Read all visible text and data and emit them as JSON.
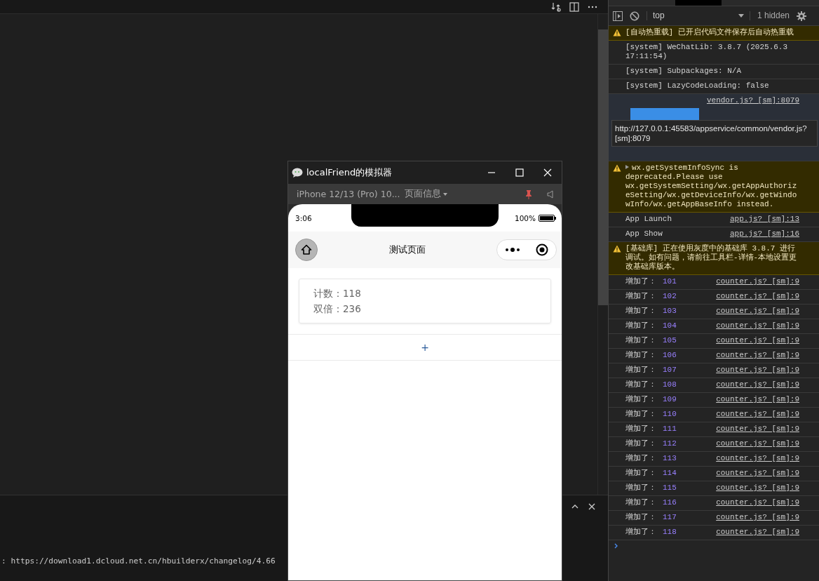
{
  "editor": {
    "output_line": ": https://download1.dcloud.net.cn/hbuilderx/changelog/4.66"
  },
  "simulator": {
    "title": "localFriend的模拟器",
    "device": "iPhone 12/13 (Pro) 10...",
    "page_info": "页面信息",
    "time": "3:06",
    "battery": "100%",
    "nav_title": "测试页面",
    "card_lines": [
      "计数：118",
      "双倍：236"
    ],
    "button": "+"
  },
  "console": {
    "context": "top",
    "hidden": "1 hidden",
    "tooltip": "http://127.0.0.1:45583/appservice/common/vendor.js?[sm]:8079",
    "messages": [
      {
        "kind": "warning",
        "text": "[自动热重载] 已开启代码文件保存后自动热重载"
      },
      {
        "kind": "log",
        "text": "[system] WeChatLib: 3.8.7 (2025.6.3 17:11:54)"
      },
      {
        "kind": "log",
        "text": "[system] Subpackages: N/A"
      },
      {
        "kind": "log",
        "text": "[system] LazyCodeLoading: false"
      },
      {
        "kind": "banner",
        "source": "vendor.js? [sm]:8079"
      },
      {
        "kind": "warning",
        "expanded": false,
        "text": "wx.getSystemInfoSync is deprecated.Please use wx.getSystemSetting/wx.getAppAuthorizeSetting/wx.getDeviceInfo/wx.getWindowInfo/wx.getAppBaseInfo instead."
      },
      {
        "kind": "log",
        "text": "App Launch",
        "source": "app.js? [sm]:13"
      },
      {
        "kind": "log",
        "text": "App Show",
        "source": "app.js? [sm]:16"
      },
      {
        "kind": "warning",
        "text": "[基础库] 正在使用灰度中的基础库 3.8.7 进行调试。如有问题，请前往工具栏-详情-本地设置更改基础库版本。"
      },
      {
        "kind": "value",
        "text": "增加了：",
        "value": "101",
        "source": "counter.js? [sm]:9"
      },
      {
        "kind": "value",
        "text": "增加了：",
        "value": "102",
        "source": "counter.js? [sm]:9"
      },
      {
        "kind": "value",
        "text": "增加了：",
        "value": "103",
        "source": "counter.js? [sm]:9"
      },
      {
        "kind": "value",
        "text": "增加了：",
        "value": "104",
        "source": "counter.js? [sm]:9"
      },
      {
        "kind": "value",
        "text": "增加了：",
        "value": "105",
        "source": "counter.js? [sm]:9"
      },
      {
        "kind": "value",
        "text": "增加了：",
        "value": "106",
        "source": "counter.js? [sm]:9"
      },
      {
        "kind": "value",
        "text": "增加了：",
        "value": "107",
        "source": "counter.js? [sm]:9"
      },
      {
        "kind": "value",
        "text": "增加了：",
        "value": "108",
        "source": "counter.js? [sm]:9"
      },
      {
        "kind": "value",
        "text": "增加了：",
        "value": "109",
        "source": "counter.js? [sm]:9"
      },
      {
        "kind": "value",
        "text": "增加了：",
        "value": "110",
        "source": "counter.js? [sm]:9"
      },
      {
        "kind": "value",
        "text": "增加了：",
        "value": "111",
        "source": "counter.js? [sm]:9"
      },
      {
        "kind": "value",
        "text": "增加了：",
        "value": "112",
        "source": "counter.js? [sm]:9"
      },
      {
        "kind": "value",
        "text": "增加了：",
        "value": "113",
        "source": "counter.js? [sm]:9"
      },
      {
        "kind": "value",
        "text": "增加了：",
        "value": "114",
        "source": "counter.js? [sm]:9"
      },
      {
        "kind": "value",
        "text": "增加了：",
        "value": "115",
        "source": "counter.js? [sm]:9"
      },
      {
        "kind": "value",
        "text": "增加了：",
        "value": "116",
        "source": "counter.js? [sm]:9"
      },
      {
        "kind": "value",
        "text": "增加了：",
        "value": "117",
        "source": "counter.js? [sm]:9"
      },
      {
        "kind": "value",
        "text": "增加了：",
        "value": "118",
        "source": "counter.js? [sm]:9"
      }
    ]
  }
}
